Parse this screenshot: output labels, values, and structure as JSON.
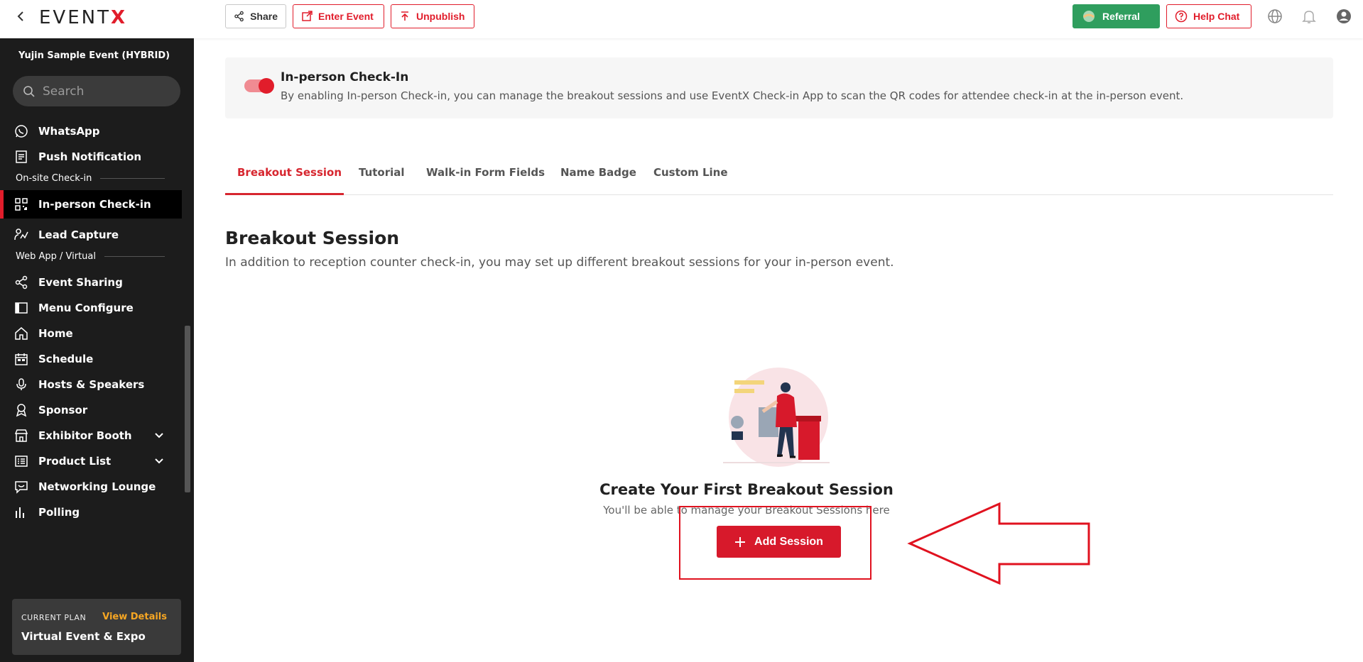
{
  "topbar": {
    "brand_main": "EVENT",
    "brand_accent": "X",
    "share_label": "Share",
    "enter_event_label": "Enter Event",
    "unpublish_label": "Unpublish",
    "referral_label": "Referral",
    "help_chat_label": "Help Chat"
  },
  "sidebar": {
    "event_name": "Yujin Sample Event (HYBRID)",
    "search_placeholder": "Search",
    "items": [
      {
        "label": "WhatsApp",
        "icon": "whatsapp-icon"
      },
      {
        "label": "Push Notification",
        "icon": "push-notification-icon"
      },
      {
        "label": "In-person Check-in",
        "icon": "qr-code-icon",
        "active": true
      },
      {
        "label": "Lead Capture",
        "icon": "lead-capture-icon"
      },
      {
        "label": "Event Sharing",
        "icon": "share-icon"
      },
      {
        "label": "Menu Configure",
        "icon": "menu-configure-icon"
      },
      {
        "label": "Home",
        "icon": "home-icon"
      },
      {
        "label": "Schedule",
        "icon": "calendar-icon"
      },
      {
        "label": "Hosts & Speakers",
        "icon": "microphone-icon"
      },
      {
        "label": "Sponsor",
        "icon": "sponsor-icon"
      },
      {
        "label": "Exhibitor Booth",
        "icon": "booth-icon"
      },
      {
        "label": "Product List",
        "icon": "product-list-icon"
      },
      {
        "label": "Networking Lounge",
        "icon": "chat-icon"
      },
      {
        "label": "Polling",
        "icon": "poll-icon"
      }
    ],
    "sections": {
      "onsite": "On-site Check-in",
      "webapp": "Web App / Virtual"
    },
    "plan": {
      "label": "CURRENT PLAN",
      "view_details": "View Details",
      "name": "Virtual Event & Expo"
    }
  },
  "main": {
    "toggle": {
      "title": "In-person Check-In",
      "description": "By enabling In-person Check-in, you can manage the breakout sessions and use EventX Check-in App to scan the QR codes for attendee check-in at the in-person event.",
      "enabled": true
    },
    "tabs": [
      {
        "label": "Breakout Session",
        "active": true
      },
      {
        "label": "Tutorial"
      },
      {
        "label": "Walk-in Form Fields"
      },
      {
        "label": "Name Badge"
      },
      {
        "label": "Custom Line"
      }
    ],
    "section_title": "Breakout Session",
    "section_description": "In addition to reception counter check-in, you may set up different breakout sessions for your in-person event.",
    "empty_state": {
      "title": "Create Your First Breakout Session",
      "subtitle": "You'll be able to manage your Breakout Sessions here",
      "button_label": "Add Session"
    }
  },
  "colors": {
    "accent": "#e11d2b",
    "sidebar_bg": "#1c1c1c",
    "referral_green": "#2f9e5e",
    "plan_link": "#f6a623"
  }
}
